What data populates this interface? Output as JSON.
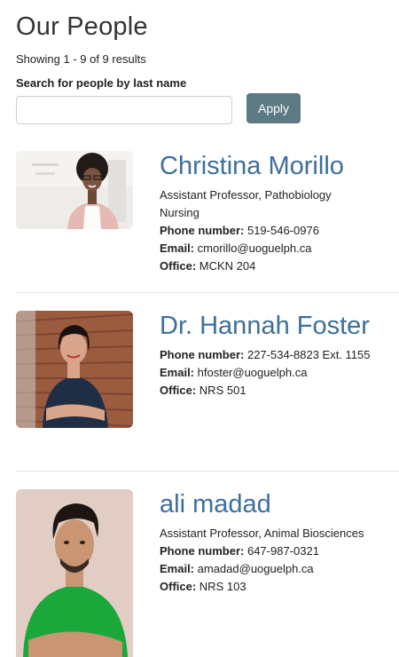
{
  "page": {
    "title": "Our People",
    "results_count": "Showing 1 - 9 of 9 results"
  },
  "search": {
    "label": "Search for people by last name",
    "value": "",
    "placeholder": "",
    "apply_label": "Apply"
  },
  "people": [
    {
      "name": "Christina Morillo",
      "role": "Assistant Professor, Pathobiology",
      "department": "Nursing",
      "phone_label": "Phone number:",
      "phone": "519-546-0976",
      "email_label": "Email:",
      "email": "cmorillo@uoguelph.ca",
      "office_label": "Office:",
      "office": "MCKN 204"
    },
    {
      "name": "Dr. Hannah Foster",
      "phone_label": "Phone number:",
      "phone": "227-534-8823 Ext. 1155",
      "email_label": "Email:",
      "email": "hfoster@uoguelph.ca",
      "office_label": "Office:",
      "office": "NRS 501"
    },
    {
      "name": "ali madad",
      "role": "Assistant Professor, Animal Biosciences",
      "phone_label": "Phone number:",
      "phone": "647-987-0321",
      "email_label": "Email:",
      "email": "amadad@uoguelph.ca",
      "office_label": "Office:",
      "office": "NRS 103"
    }
  ],
  "colors": {
    "name_link": "#3d6f9c",
    "apply_button": "#5c7a84",
    "divider": "#e6e6e6"
  }
}
